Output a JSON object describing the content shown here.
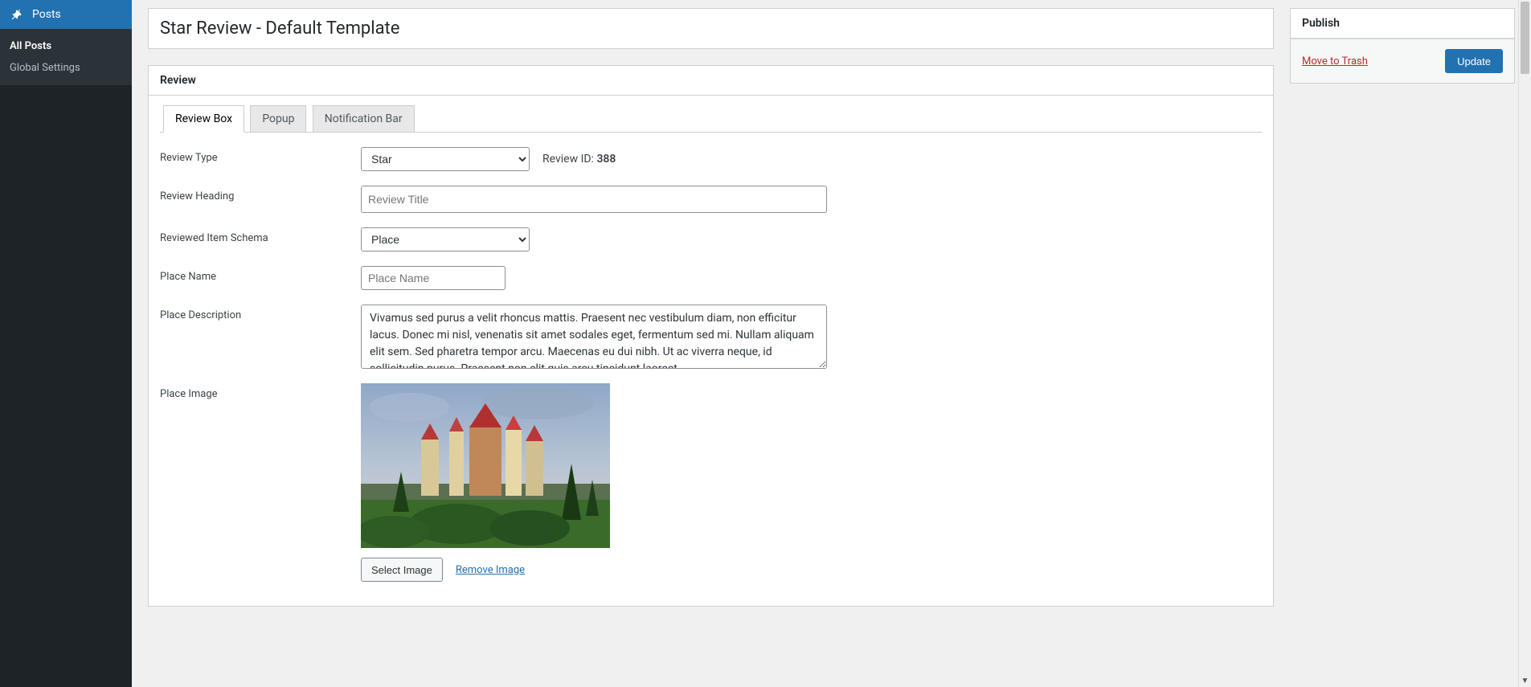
{
  "sidebar": {
    "menu_label": "Posts",
    "submenu": [
      {
        "label": "All Posts",
        "current": true
      },
      {
        "label": "Global Settings",
        "current": false
      }
    ]
  },
  "page": {
    "title": "Star Review - Default Template"
  },
  "review_box": {
    "header": "Review",
    "tabs": [
      {
        "label": "Review Box",
        "active": true
      },
      {
        "label": "Popup",
        "active": false
      },
      {
        "label": "Notification Bar",
        "active": false
      }
    ],
    "fields": {
      "review_type_label": "Review Type",
      "review_type_value": "Star",
      "review_id_label": "Review ID:",
      "review_id_value": "388",
      "review_heading_label": "Review Heading",
      "review_heading_placeholder": "Review Title",
      "schema_label": "Reviewed Item Schema",
      "schema_value": "Place",
      "place_name_label": "Place Name",
      "place_name_placeholder": "Place Name",
      "place_desc_label": "Place Description",
      "place_desc_value": "Vivamus sed purus a velit rhoncus mattis. Praesent nec vestibulum diam, non efficitur lacus. Donec mi nisl, venenatis sit amet sodales eget, fermentum sed mi. Nullam aliquam elit sem. Sed pharetra tempor arcu. Maecenas eu dui nibh. Ut ac viverra neque, id sollicitudin purus. Praesent non elit quis arcu tincidunt laoreet.",
      "place_image_label": "Place Image",
      "select_image_btn": "Select Image",
      "remove_image_link": "Remove Image"
    }
  },
  "publish": {
    "header": "Publish",
    "trash_link": "Move to Trash",
    "update_btn": "Update"
  }
}
